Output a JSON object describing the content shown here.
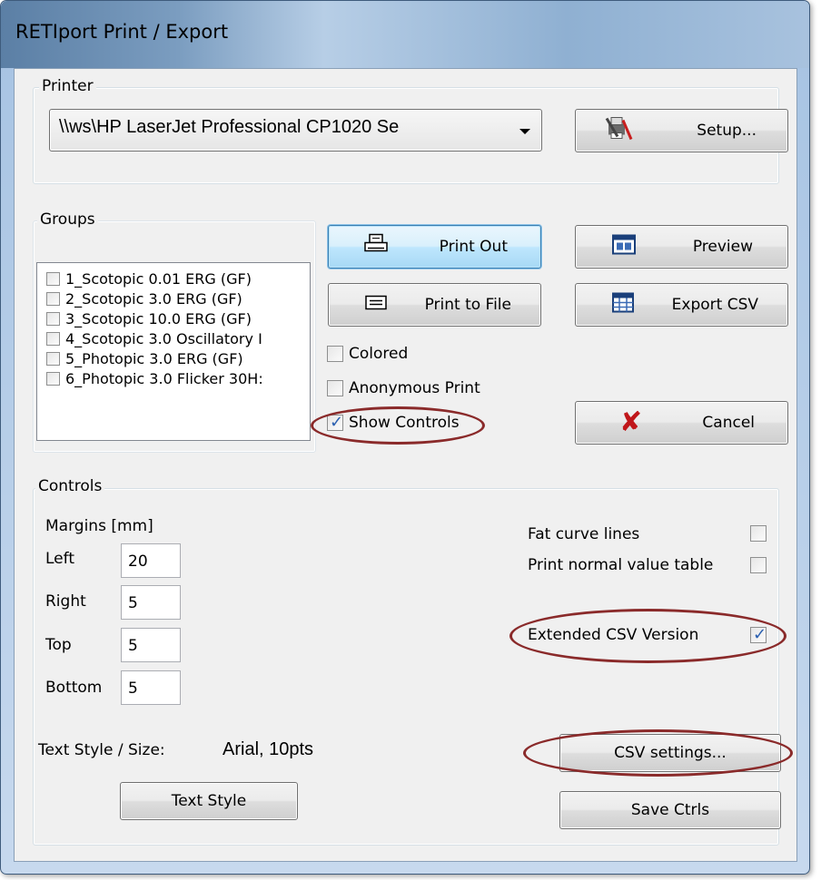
{
  "window": {
    "title": "RETIport Print / Export"
  },
  "printer": {
    "group_label": "Printer",
    "selected": "\\\\ws\\HP LaserJet Professional CP1020 Se",
    "setup_button": "Setup..."
  },
  "groups": {
    "group_label": "Groups",
    "items": [
      {
        "label": "1_Scotopic 0.01 ERG (GF)",
        "checked": false
      },
      {
        "label": "2_Scotopic 3.0 ERG (GF)",
        "checked": false
      },
      {
        "label": "3_Scotopic 10.0 ERG (GF)",
        "checked": false
      },
      {
        "label": "4_Scotopic 3.0 Oscillatory I",
        "checked": false
      },
      {
        "label": "5_Photopic 3.0 ERG (GF)",
        "checked": false
      },
      {
        "label": "6_Photopic 3.0 Flicker 30H:",
        "checked": false
      }
    ]
  },
  "actions": {
    "print_out": "Print Out",
    "print_to_file": "Print to File",
    "preview": "Preview",
    "export_csv": "Export CSV",
    "cancel": "Cancel"
  },
  "options": {
    "colored": {
      "label": "Colored",
      "checked": false
    },
    "anonymous_print": {
      "label": "Anonymous Print",
      "checked": false
    },
    "show_controls": {
      "label": "Show Controls",
      "checked": true
    }
  },
  "controls": {
    "group_label": "Controls",
    "margins_label": "Margins [mm]",
    "left": {
      "label": "Left",
      "value": "20"
    },
    "right": {
      "label": "Right",
      "value": "5"
    },
    "top": {
      "label": "Top",
      "value": "5"
    },
    "bottom": {
      "label": "Bottom",
      "value": "5"
    },
    "fat_curve_lines": {
      "label": "Fat curve lines",
      "checked": false
    },
    "print_normal_value_table": {
      "label": "Print normal value table",
      "checked": false
    },
    "extended_csv_version": {
      "label": "Extended CSV Version",
      "checked": true
    },
    "text_style_label": "Text Style / Size:",
    "text_style_value": "Arial, 10pts",
    "text_style_button": "Text Style",
    "csv_settings_button": "CSV settings...",
    "save_ctrls_button": "Save Ctrls"
  },
  "colors": {
    "annotation_circle": "#8a2a2a",
    "focus_border": "#3c7fb1"
  }
}
